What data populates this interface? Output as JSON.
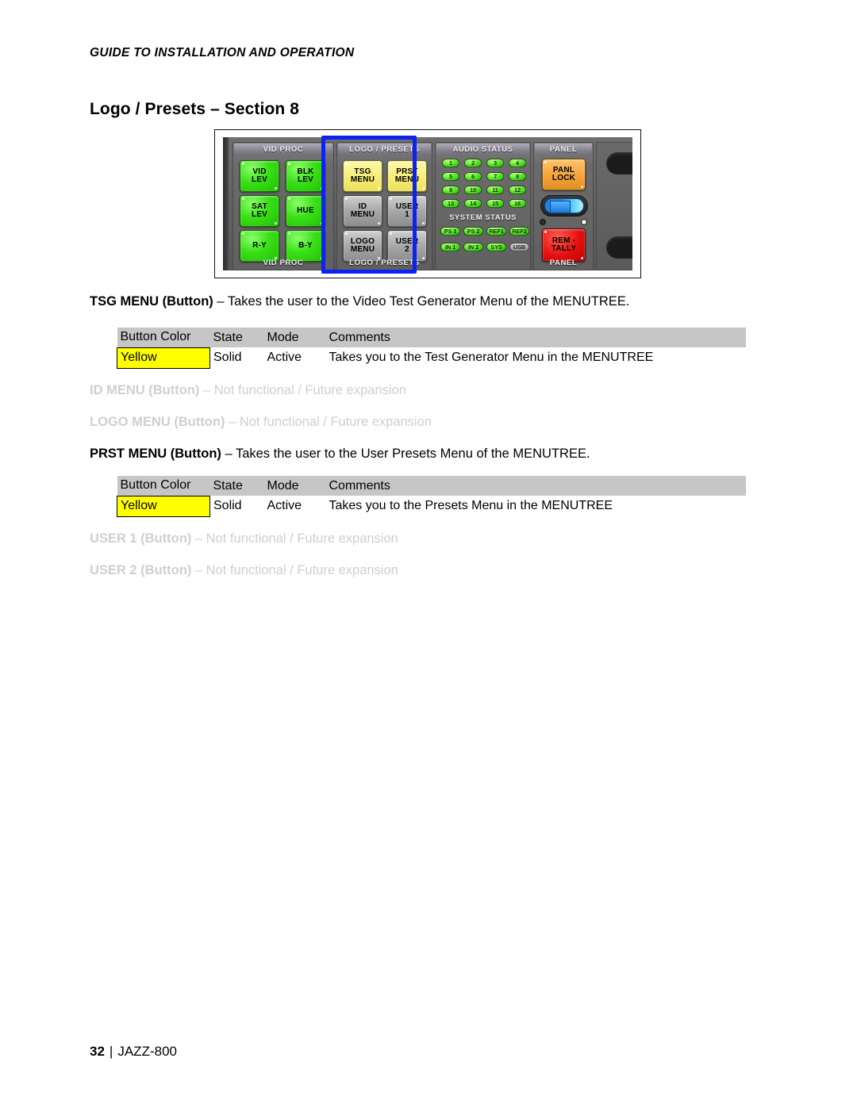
{
  "header": {
    "running_head": "GUIDE TO INSTALLATION AND OPERATION"
  },
  "heading": {
    "title": "Logo / Presets – Section 8"
  },
  "figure": {
    "caption_groups": {
      "vid_proc_top": "VID PROC",
      "vid_proc_bottom": "VID PROC",
      "logo_presets_top": "LOGO / PRESETS",
      "logo_presets_bottom": "LOGO / PRESETS",
      "audio_status": "AUDIO STATUS",
      "system_status": "SYSTEM STATUS",
      "panel_top": "PANEL",
      "panel_bottom": "PANEL"
    },
    "vid_proc_buttons": [
      {
        "label_top": "VID",
        "label_bottom": "LEV",
        "color": "green"
      },
      {
        "label_top": "BLK",
        "label_bottom": "LEV",
        "color": "green"
      },
      {
        "label_top": "SAT",
        "label_bottom": "LEV",
        "color": "green"
      },
      {
        "label_top": "HUE",
        "label_bottom": "",
        "color": "green"
      },
      {
        "label_top": "R-Y",
        "label_bottom": "",
        "color": "green"
      },
      {
        "label_top": "B-Y",
        "label_bottom": "",
        "color": "green"
      }
    ],
    "logo_presets_buttons": [
      {
        "label_top": "TSG",
        "label_bottom": "MENU",
        "color": "yellow"
      },
      {
        "label_top": "PRST",
        "label_bottom": "MENU",
        "color": "yellow"
      },
      {
        "label_top": "ID",
        "label_bottom": "MENU",
        "color": "gray"
      },
      {
        "label_top": "USER",
        "label_bottom": "1",
        "color": "gray"
      },
      {
        "label_top": "LOGO",
        "label_bottom": "MENU",
        "color": "gray"
      },
      {
        "label_top": "USER",
        "label_bottom": "2",
        "color": "gray"
      }
    ],
    "audio_leds": [
      {
        "label": "1",
        "state": "on"
      },
      {
        "label": "2",
        "state": "on"
      },
      {
        "label": "3",
        "state": "on"
      },
      {
        "label": "4",
        "state": "on"
      },
      {
        "label": "5",
        "state": "on"
      },
      {
        "label": "6",
        "state": "on"
      },
      {
        "label": "7",
        "state": "on"
      },
      {
        "label": "8",
        "state": "on"
      },
      {
        "label": "9",
        "state": "on"
      },
      {
        "label": "10",
        "state": "on"
      },
      {
        "label": "11",
        "state": "on"
      },
      {
        "label": "12",
        "state": "on"
      },
      {
        "label": "13",
        "state": "on"
      },
      {
        "label": "14",
        "state": "on"
      },
      {
        "label": "15",
        "state": "on"
      },
      {
        "label": "16",
        "state": "on"
      }
    ],
    "system_leds": [
      {
        "label": "PS 1",
        "state": "on"
      },
      {
        "label": "PS 2",
        "state": "on"
      },
      {
        "label": "REF1",
        "state": "on"
      },
      {
        "label": "REF2",
        "state": "on"
      },
      {
        "label": "IN 1",
        "state": "on"
      },
      {
        "label": "IN 2",
        "state": "on"
      },
      {
        "label": "SYS",
        "state": "on"
      },
      {
        "label": "USB",
        "state": "off"
      }
    ],
    "panel_buttons": [
      {
        "label_top": "PANL",
        "label_bottom": "LOCK",
        "color": "orange"
      },
      {
        "label_top": "REM -",
        "label_bottom": "TALLY",
        "color": "red"
      }
    ],
    "highlight_color": "#0b22f0"
  },
  "sections": [
    {
      "id": "tsg-menu",
      "term": "TSG MENU (Button)",
      "description": " – Takes the user to the Video Test Generator Menu of the MENUTREE.",
      "muted": false,
      "table": {
        "headers": [
          "Button Color",
          "State",
          "Mode",
          "Comments"
        ],
        "rows": [
          {
            "color": "Yellow",
            "state": "Solid",
            "mode": "Active",
            "comments": "Takes you to the Test Generator Menu in the MENUTREE",
            "swatch_hex": "#ffff00"
          }
        ]
      }
    },
    {
      "id": "id-menu",
      "term": "ID MENU (Button)",
      "description": " – Not functional / Future expansion",
      "muted": true,
      "table": null
    },
    {
      "id": "logo-menu",
      "term": "LOGO MENU (Button)",
      "description": " – Not functional / Future expansion",
      "muted": true,
      "table": null
    },
    {
      "id": "prst-menu",
      "term": "PRST MENU (Button)",
      "description": " – Takes the user to the User Presets Menu of the MENUTREE.",
      "muted": false,
      "table": {
        "headers": [
          "Button Color",
          "State",
          "Mode",
          "Comments"
        ],
        "rows": [
          {
            "color": "Yellow",
            "state": "Solid",
            "mode": "Active",
            "comments": "Takes you to the Presets Menu in the MENUTREE",
            "swatch_hex": "#ffff00"
          }
        ]
      }
    },
    {
      "id": "user-1",
      "term": "USER 1 (Button)",
      "description": " – Not functional / Future expansion",
      "muted": true,
      "table": null
    },
    {
      "id": "user-2",
      "term": "USER 2 (Button)",
      "description": " – Not functional / Future expansion",
      "muted": true,
      "table": null
    }
  ],
  "footer": {
    "page_number": "32",
    "separator": "|",
    "product": "JAZZ-800"
  }
}
